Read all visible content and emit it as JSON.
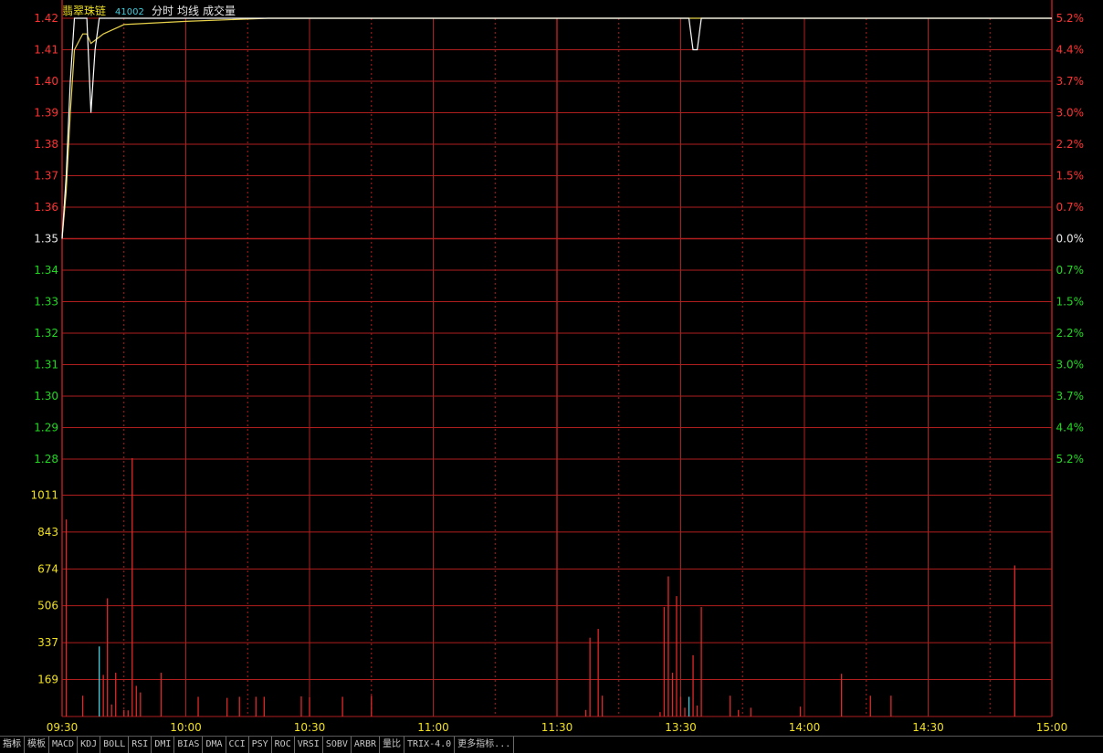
{
  "header": {
    "stock_name": "翡翠珠链",
    "stock_code": "41002",
    "legend_items": [
      "分时",
      "均线",
      "成交量"
    ]
  },
  "colors": {
    "background": "#000000",
    "grid": "#b01e1e",
    "up": "#ff3232",
    "down": "#20d820",
    "neutral": "#e8e8e8",
    "volume_axis": "#f0e020",
    "price_line": "#ffffff",
    "avg_line": "#e8d24a",
    "volume_up": "#e02828",
    "volume_down": "#40d0e0",
    "time_label": "#f0e020",
    "title": "#f0e020",
    "code": "#40d0e0"
  },
  "chart_data": {
    "type": "line",
    "price_axis": {
      "left_ticks": [
        "1.42",
        "1.41",
        "1.40",
        "1.39",
        "1.38",
        "1.37",
        "1.36",
        "1.35",
        "1.34",
        "1.33",
        "1.32",
        "1.31",
        "1.30",
        "1.29",
        "1.28"
      ],
      "right_ticks": [
        "5.2%",
        "4.4%",
        "3.7%",
        "3.0%",
        "2.2%",
        "1.5%",
        "0.7%",
        "0.0%",
        "0.7%",
        "1.5%",
        "2.2%",
        "3.0%",
        "3.7%",
        "4.4%",
        "5.2%"
      ],
      "prev_close": 1.35,
      "ylim": [
        1.28,
        1.42
      ]
    },
    "volume_axis": {
      "ticks": [
        "1011",
        "843",
        "674",
        "506",
        "337",
        "169"
      ],
      "ylim": [
        0,
        1180
      ]
    },
    "time_labels": [
      "09:30",
      "10:00",
      "10:30",
      "11:00",
      "11:30",
      "13:30",
      "14:00",
      "14:30",
      "15:00"
    ],
    "total_minutes": 240,
    "price_series": [
      [
        0,
        1.35
      ],
      [
        1,
        1.37
      ],
      [
        2,
        1.4
      ],
      [
        3,
        1.42
      ],
      [
        6,
        1.42
      ],
      [
        7,
        1.39
      ],
      [
        8,
        1.41
      ],
      [
        9,
        1.42
      ],
      [
        10,
        1.42
      ],
      [
        11,
        1.42
      ],
      [
        12,
        1.42
      ],
      [
        13,
        1.42
      ],
      [
        14,
        1.42
      ],
      [
        15,
        1.42
      ],
      [
        16,
        1.42
      ],
      [
        17,
        1.42
      ],
      [
        18,
        1.42
      ],
      [
        19,
        1.42
      ],
      [
        60,
        1.42
      ],
      [
        145,
        1.42
      ],
      [
        152,
        1.42
      ],
      [
        153,
        1.41
      ],
      [
        154,
        1.41
      ],
      [
        155,
        1.42
      ],
      [
        156,
        1.42
      ],
      [
        240,
        1.42
      ]
    ],
    "avg_series": [
      [
        0,
        1.35
      ],
      [
        1,
        1.365
      ],
      [
        2,
        1.39
      ],
      [
        3,
        1.41
      ],
      [
        5,
        1.415
      ],
      [
        6,
        1.415
      ],
      [
        7,
        1.412
      ],
      [
        8,
        1.413
      ],
      [
        10,
        1.415
      ],
      [
        15,
        1.418
      ],
      [
        30,
        1.419
      ],
      [
        50,
        1.42
      ],
      [
        140,
        1.42
      ],
      [
        240,
        1.42
      ]
    ],
    "volume_bars": [
      {
        "t": 1,
        "v": 900,
        "d": "up"
      },
      {
        "t": 5,
        "v": 95,
        "d": "up"
      },
      {
        "t": 9,
        "v": 320,
        "d": "down"
      },
      {
        "t": 10,
        "v": 190,
        "d": "up"
      },
      {
        "t": 11,
        "v": 540,
        "d": "up"
      },
      {
        "t": 12,
        "v": 55,
        "d": "up"
      },
      {
        "t": 13,
        "v": 200,
        "d": "up"
      },
      {
        "t": 15,
        "v": 30,
        "d": "up"
      },
      {
        "t": 16,
        "v": 28,
        "d": "up"
      },
      {
        "t": 17,
        "v": 1180,
        "d": "up"
      },
      {
        "t": 18,
        "v": 140,
        "d": "up"
      },
      {
        "t": 19,
        "v": 110,
        "d": "up"
      },
      {
        "t": 24,
        "v": 200,
        "d": "up"
      },
      {
        "t": 33,
        "v": 90,
        "d": "up"
      },
      {
        "t": 40,
        "v": 85,
        "d": "up"
      },
      {
        "t": 43,
        "v": 90,
        "d": "up"
      },
      {
        "t": 47,
        "v": 90,
        "d": "up"
      },
      {
        "t": 49,
        "v": 90,
        "d": "up"
      },
      {
        "t": 58,
        "v": 92,
        "d": "up"
      },
      {
        "t": 60,
        "v": 88,
        "d": "up"
      },
      {
        "t": 68,
        "v": 90,
        "d": "up"
      },
      {
        "t": 75,
        "v": 95,
        "d": "up"
      },
      {
        "t": 127,
        "v": 30,
        "d": "up"
      },
      {
        "t": 128,
        "v": 360,
        "d": "up"
      },
      {
        "t": 130,
        "v": 400,
        "d": "up"
      },
      {
        "t": 131,
        "v": 95,
        "d": "up"
      },
      {
        "t": 145,
        "v": 20,
        "d": "up"
      },
      {
        "t": 146,
        "v": 500,
        "d": "up"
      },
      {
        "t": 147,
        "v": 640,
        "d": "up"
      },
      {
        "t": 148,
        "v": 200,
        "d": "up"
      },
      {
        "t": 149,
        "v": 550,
        "d": "up"
      },
      {
        "t": 150,
        "v": 90,
        "d": "up"
      },
      {
        "t": 151,
        "v": 40,
        "d": "up"
      },
      {
        "t": 152,
        "v": 90,
        "d": "down"
      },
      {
        "t": 153,
        "v": 280,
        "d": "up"
      },
      {
        "t": 154,
        "v": 50,
        "d": "up"
      },
      {
        "t": 155,
        "v": 500,
        "d": "up"
      },
      {
        "t": 162,
        "v": 95,
        "d": "up"
      },
      {
        "t": 164,
        "v": 30,
        "d": "up"
      },
      {
        "t": 167,
        "v": 40,
        "d": "up"
      },
      {
        "t": 179,
        "v": 45,
        "d": "up"
      },
      {
        "t": 189,
        "v": 195,
        "d": "up"
      },
      {
        "t": 196,
        "v": 95,
        "d": "up"
      },
      {
        "t": 201,
        "v": 95,
        "d": "up"
      },
      {
        "t": 231,
        "v": 690,
        "d": "up"
      }
    ]
  },
  "tabs": [
    "指标",
    "模板",
    "MACD",
    "KDJ",
    "BOLL",
    "RSI",
    "DMI",
    "BIAS",
    "DMA",
    "CCI",
    "PSY",
    "ROC",
    "VRSI",
    "SOBV",
    "ARBR",
    "量比",
    "TRIX-4.0",
    "更多指标..."
  ]
}
